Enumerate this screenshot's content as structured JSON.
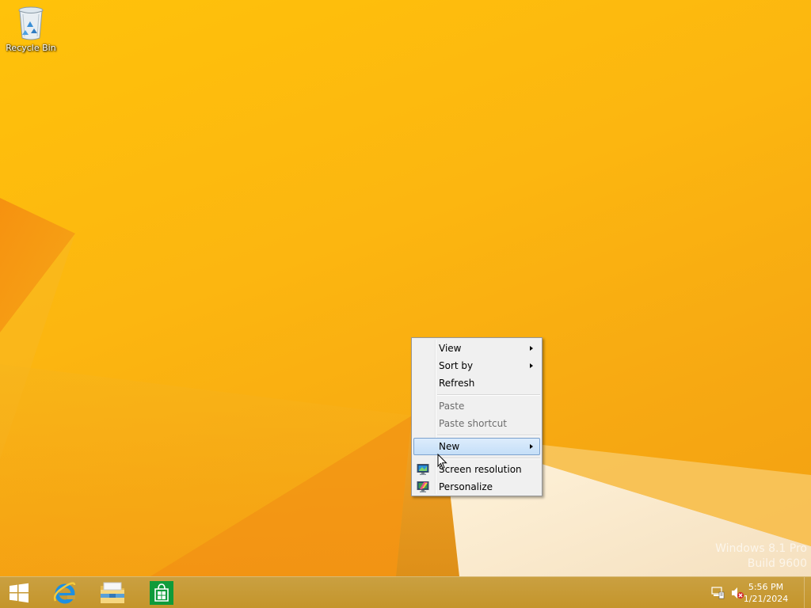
{
  "desktop": {
    "icons": [
      {
        "label": "Recycle Bin",
        "icon": "recycle-bin-icon"
      }
    ],
    "watermark": {
      "line1": "Windows 8.1 Pro",
      "line2": "Build 9600"
    }
  },
  "context_menu": {
    "items": {
      "view": {
        "label": "View",
        "submenu": true
      },
      "sort_by": {
        "label": "Sort by",
        "submenu": true
      },
      "refresh": {
        "label": "Refresh"
      },
      "paste": {
        "label": "Paste",
        "disabled": true
      },
      "paste_shortcut": {
        "label": "Paste shortcut",
        "disabled": true
      },
      "new": {
        "label": "New",
        "submenu": true,
        "highlighted": true
      },
      "screen_resolution": {
        "label": "Screen resolution",
        "icon": "monitor-icon"
      },
      "personalize": {
        "label": "Personalize",
        "icon": "personalize-icon"
      }
    }
  },
  "taskbar": {
    "pinned": [
      "start-button",
      "internet-explorer-icon",
      "file-explorer-icon",
      "store-icon"
    ],
    "tray": {
      "icons": [
        "network-icon",
        "volume-muted-icon"
      ],
      "time": "5:56 PM",
      "date": "1/21/2024"
    }
  },
  "colors": {
    "wallpaper_accent": "#fcb610",
    "taskbar": "#c4952b",
    "menu_highlight": "#c5dff8"
  }
}
